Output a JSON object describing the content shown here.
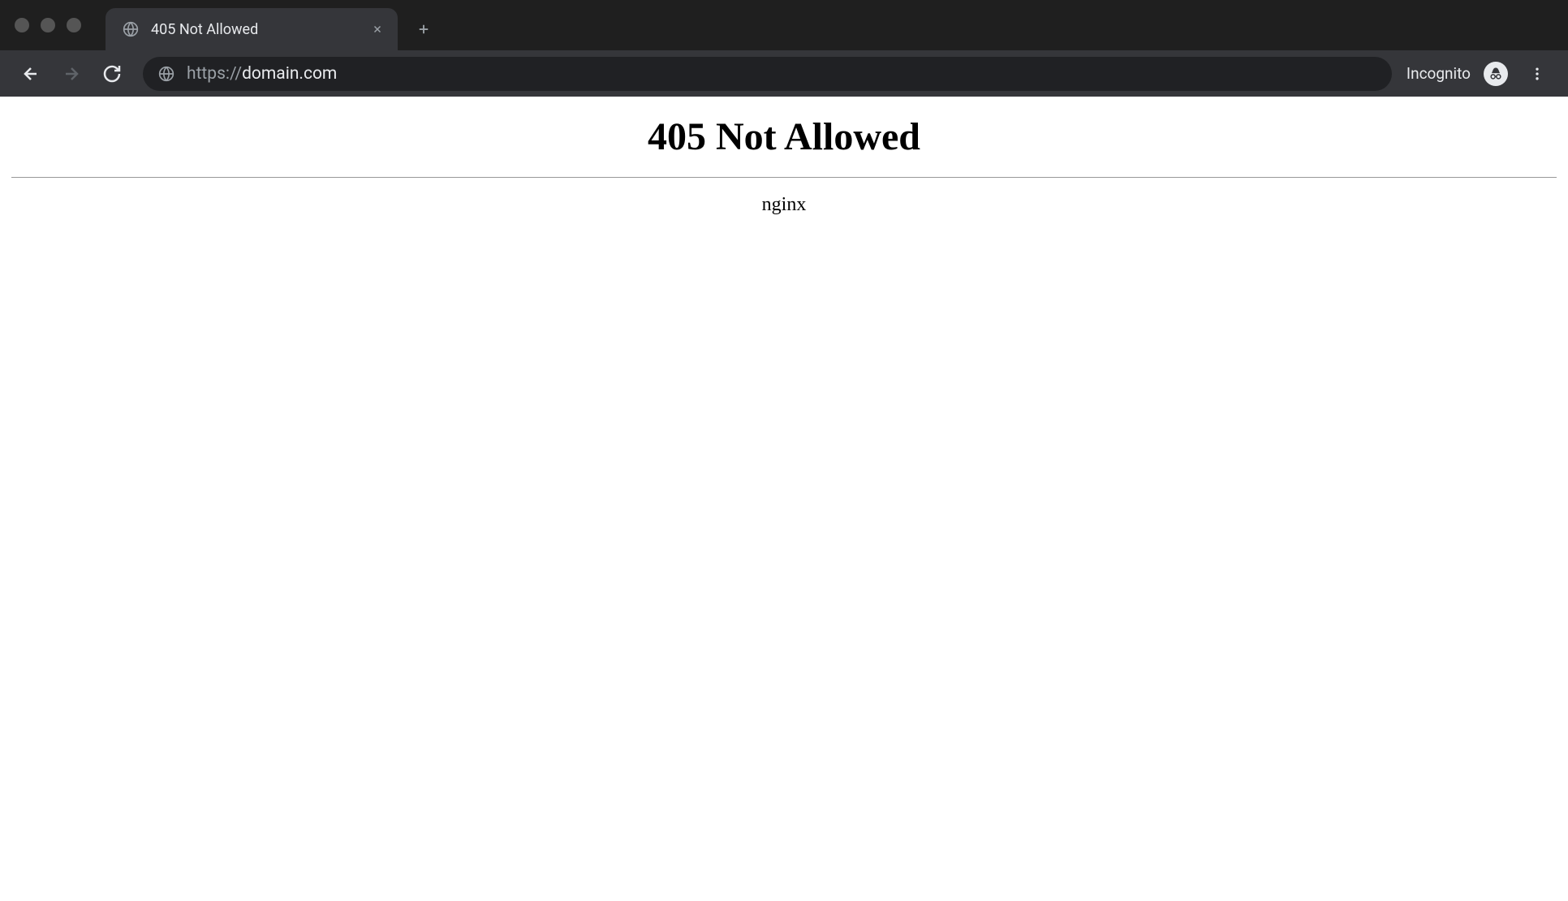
{
  "browser": {
    "tab": {
      "title": "405 Not Allowed"
    },
    "addressbar": {
      "protocol": "https://",
      "domain": "domain.com"
    },
    "incognito_label": "Incognito"
  },
  "page": {
    "heading": "405 Not Allowed",
    "server": "nginx"
  }
}
